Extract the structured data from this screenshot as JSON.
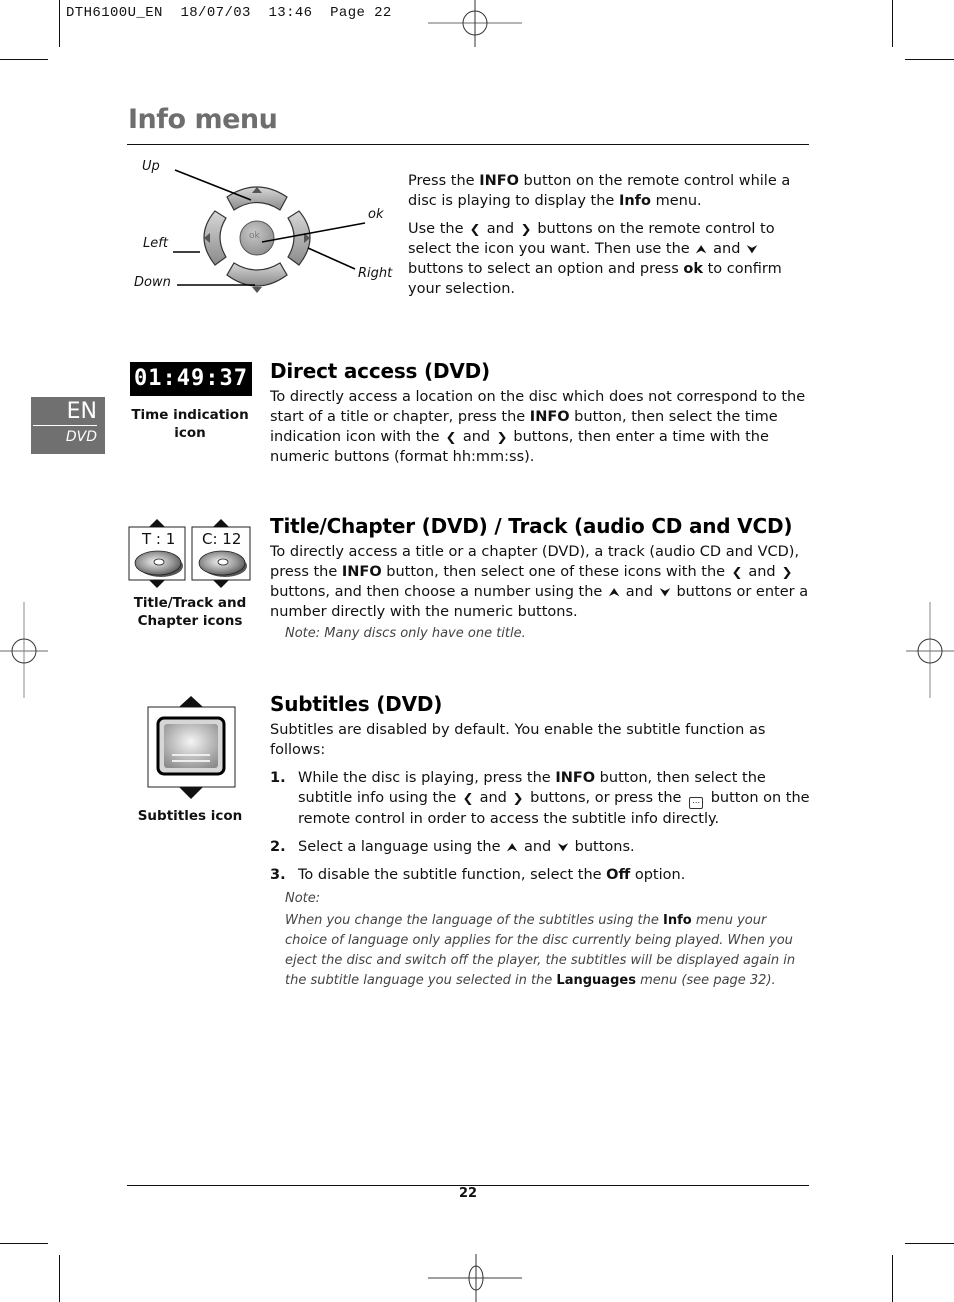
{
  "print_slug": {
    "file": "DTH6100U_EN",
    "date": "18/07/03",
    "time": "13:46",
    "page_label": "Page 22"
  },
  "page_title": "Info menu",
  "language_tab": {
    "code": "EN",
    "section": "DVD",
    "color": "#707070"
  },
  "remote_diagram": {
    "labels": {
      "up": "Up",
      "left": "Left",
      "down": "Down",
      "ok": "ok",
      "right": "Right"
    },
    "center_button_text": "ok"
  },
  "intro": {
    "p1": {
      "a": "Press the ",
      "b1": "INFO",
      "c": " button on the remote control while a disc is playing to display the ",
      "b2": "Info",
      "d": " menu."
    },
    "p2": {
      "a": "Use the",
      "and1": "and",
      "b": "buttons on the remote control to select the icon you want. Then use the",
      "and2": "and",
      "c": "buttons to select an option and press ",
      "bold_ok": "ok",
      "d": " to confirm your selection."
    }
  },
  "glyphs": {
    "left": "❮",
    "right": "❯",
    "up": "⮝",
    "down": "⮟",
    "left_arrow_icon": "left-arrow-icon",
    "right_arrow_icon": "right-arrow-icon",
    "up_arrow_icon": "up-arrow-icon",
    "down_arrow_icon": "down-arrow-icon"
  },
  "direct_access": {
    "icon_value": "01:49:37",
    "caption_line1": "Time indication",
    "caption_line2": "icon",
    "heading": "Direct access (DVD)",
    "text_a": "To directly access a location on the disc which does not correspond to the start of a title or chapter, press the ",
    "text_bold": "INFO",
    "text_b": " button, then select the time indication icon with the",
    "text_and": "and",
    "text_c": "buttons, then enter a time with the numeric buttons (format hh:mm:ss)."
  },
  "title_chapter": {
    "icon_title": "T : 1",
    "icon_chapter": "C: 12",
    "caption_line1": "Title/Track and",
    "caption_line2": "Chapter icons",
    "heading": "Title/Chapter (DVD) / Track (audio CD and VCD)",
    "text_a": "To directly access a title or a chapter (DVD), a track (audio CD and VCD), press the ",
    "text_bold": "INFO",
    "text_b": " button, then select one of these icons with the",
    "text_and1": "and",
    "text_c": "buttons, and then choose a number using the",
    "text_and2": "and",
    "text_d": "buttons or enter a number directly with the numeric buttons.",
    "note": "Note: Many discs only have one title."
  },
  "subtitles": {
    "caption": "Subtitles icon",
    "heading": "Subtitles (DVD)",
    "intro": "Subtitles are disabled by default. You enable the subtitle function as follows:",
    "steps": [
      {
        "num": "1.",
        "a": "While the disc is playing, press the ",
        "bold": "INFO",
        "b": " button, then select the subtitle info using the",
        "and": "and",
        "c": "buttons, or press the",
        "d": "button on the remote control in order to access the subtitle info directly."
      },
      {
        "num": "2.",
        "a": "Select a language using the",
        "and": "and",
        "b": "buttons."
      },
      {
        "num": "3.",
        "a": "To disable the subtitle function, select the ",
        "bold": "Off",
        "b": " option."
      }
    ],
    "note_label": "Note:",
    "note_a": "When you change the language of the subtitles using the ",
    "note_bold1": "Info",
    "note_b": " menu your choice of language only applies for the disc currently being played. When you eject the disc and switch off the player, the subtitles will be displayed again in the subtitle language you selected in the ",
    "note_bold2": "Languages",
    "note_c": " menu (see page 32)."
  },
  "footer": {
    "page_number": "22"
  }
}
